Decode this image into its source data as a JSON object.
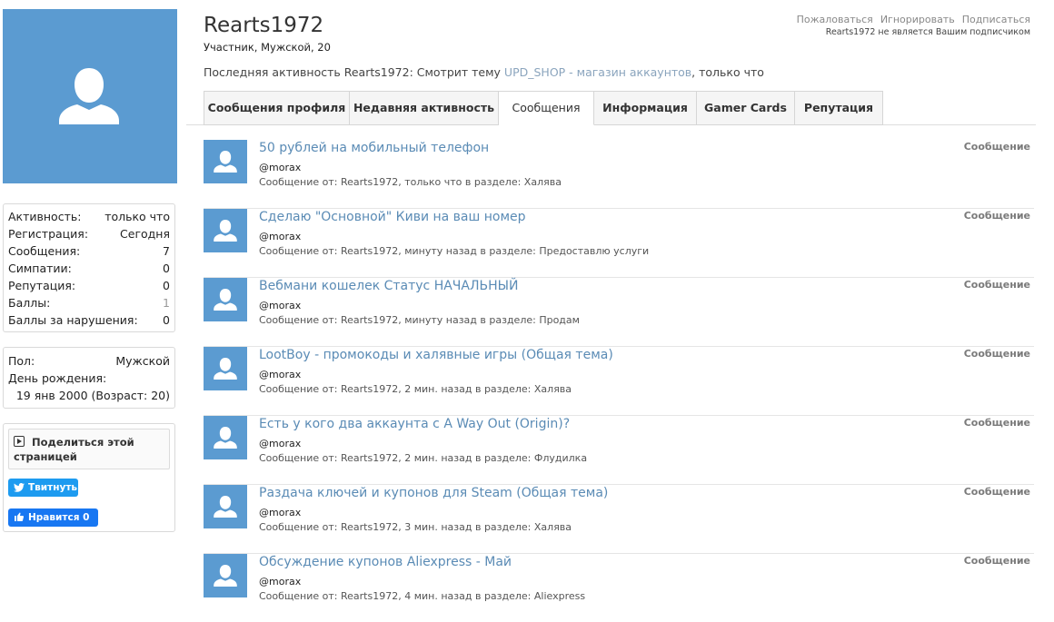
{
  "profile": {
    "username": "Rearts1972",
    "user_title": "Участник, Мужской, 20",
    "actions": [
      "Пожаловаться",
      "Игнорировать",
      "Подписаться"
    ],
    "follow_note": "Rearts1972 не является Вашим подписчиком",
    "last_activity_prefix": "Последняя активность Rearts1972: Смотрит тему ",
    "last_activity_link": "UPD_SHOP - магазин аккаунтов",
    "last_activity_suffix": ", только что"
  },
  "stats": [
    {
      "label": "Активность:",
      "value": "только что"
    },
    {
      "label": "Регистрация:",
      "value": "Сегодня"
    },
    {
      "label": "Сообщения:",
      "value": "7"
    },
    {
      "label": "Симпатии:",
      "value": "0"
    },
    {
      "label": "Репутация:",
      "value": "0"
    },
    {
      "label": "Баллы:",
      "value": "1"
    },
    {
      "label": "Баллы за нарушения:",
      "value": "0"
    }
  ],
  "info": {
    "gender_label": "Пол:",
    "gender_value": "Мужской",
    "birthday_label": "День рождения:",
    "birthday_value": "19 янв 2000 (Возраст: 20)"
  },
  "share": {
    "title": "Поделиться этой страницей",
    "tweet_label": "Твитнуть",
    "like_label": "Нравится 0"
  },
  "tabs": [
    {
      "label": "Сообщения профиля",
      "active": false
    },
    {
      "label": "Недавняя активность",
      "active": false
    },
    {
      "label": "Сообщения",
      "active": true
    },
    {
      "label": "Информация",
      "active": false
    },
    {
      "label": "Gamer Cards",
      "active": false
    },
    {
      "label": "Репутация",
      "active": false
    }
  ],
  "posts": [
    {
      "title": "50 рублей на мобильный телефон",
      "mention": "@morax",
      "meta": "Сообщение от: Rearts1972, только что в разделе: Халява",
      "type": "Сообщение"
    },
    {
      "title": "Сделаю \"Основной\" Киви на ваш номер",
      "mention": "@morax",
      "meta": "Сообщение от: Rearts1972, минуту назад в разделе: Предоставлю услуги",
      "type": "Сообщение"
    },
    {
      "title": "Вебмани кошелек Статус НАЧАЛЬНЫЙ",
      "mention": "@morax",
      "meta": "Сообщение от: Rearts1972, минуту назад в разделе: Продам",
      "type": "Сообщение"
    },
    {
      "title": "LootBoy - промокоды и халявные игры (Общая тема)",
      "mention": "@morax",
      "meta": "Сообщение от: Rearts1972, 2 мин. назад в разделе: Халява",
      "type": "Сообщение"
    },
    {
      "title": "Есть у кого два аккаунта с A Way Out (Origin)?",
      "mention": "@morax",
      "meta": "Сообщение от: Rearts1972, 2 мин. назад в разделе: Флудилка",
      "type": "Сообщение"
    },
    {
      "title": "Раздача ключей и купонов для Steam (Общая тема)",
      "mention": "@morax",
      "meta": "Сообщение от: Rearts1972, 3 мин. назад в разделе: Халява",
      "type": "Сообщение"
    },
    {
      "title": "Обсуждение купонов Aliexpress - Май",
      "mention": "@morax",
      "meta": "Сообщение от: Rearts1972, 4 мин. назад в разделе: Aliexpress",
      "type": "Сообщение"
    }
  ],
  "colors": {
    "avatar_bg": "#5b9bd1",
    "link": "#5a8bb5",
    "tweet": "#1d9bf0",
    "facebook": "#1877f2"
  }
}
